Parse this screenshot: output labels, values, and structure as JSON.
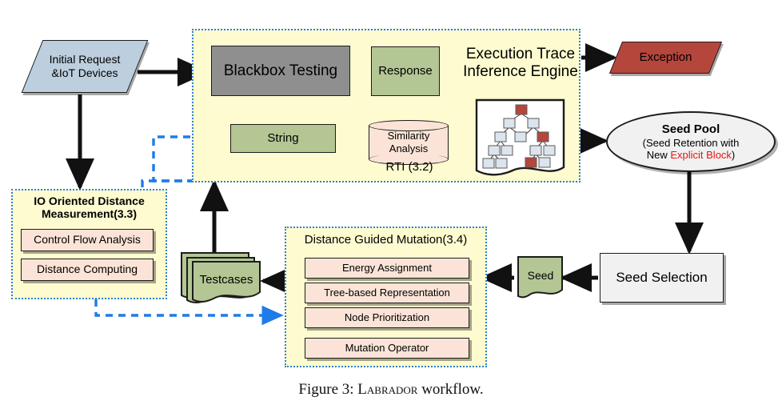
{
  "caption": {
    "prefix": "Figure 3: ",
    "name": "Labrador",
    "suffix": " workflow."
  },
  "colors": {
    "panel_fill": "#FDFBCF",
    "panel_border": "#2E7EE0",
    "green_box": "#B3C693",
    "grey_box": "#8F8F8F",
    "peach_box": "#FBE4D7",
    "light_grey_box": "#F1F1F1",
    "exception_red": "#B5463C",
    "initial_blue": "#BDCEDE",
    "blue_arrow": "#1F7BE8",
    "black_arrow": "#111111",
    "highlight_red": "#E81414"
  },
  "nodes": {
    "initial_request": {
      "line1": "Initial Request",
      "line2": "&IoT Devices",
      "shape": "parallelogram"
    },
    "blackbox_testing": {
      "label": "Blackbox Testing",
      "shape": "rect"
    },
    "response": {
      "label": "Response",
      "shape": "rect"
    },
    "string": {
      "label": "String",
      "shape": "rect"
    },
    "similarity_analysis": {
      "line1": "Similarity",
      "line2": "Analysis",
      "shape": "cylinder"
    },
    "rti_label": {
      "label": "RTI (3.2)"
    },
    "engine_title": {
      "line1": "Execution Trace",
      "line2": "Inference Engine"
    },
    "trace_tree": {
      "label": "execution-trace-tree",
      "shape": "document"
    },
    "exception": {
      "label": "Exception",
      "shape": "parallelogram"
    },
    "seed_pool": {
      "line1": "Seed Pool",
      "line2_a": "(Seed Retention with",
      "line3_a": "New ",
      "line3_b": "Explicit Block",
      "line3_c": ")",
      "shape": "ellipse"
    },
    "seed_selection": {
      "label": "Seed Selection",
      "shape": "rect"
    },
    "seed": {
      "label": "Seed",
      "shape": "document"
    },
    "testcases": {
      "label": "Testcases",
      "shape": "document-stack"
    },
    "io_panel": {
      "title_line1": "IO Oriented Distance",
      "title_line2": "Measurement(3.3)",
      "items": [
        {
          "label": "Control Flow Analysis"
        },
        {
          "label": "Distance Computing"
        }
      ]
    },
    "mutation_panel": {
      "title": "Distance Guided Mutation(3.4)",
      "items": [
        {
          "label": "Energy Assignment"
        },
        {
          "label": "Tree-based Representation"
        },
        {
          "label": "Node Prioritization"
        },
        {
          "label": "Mutation Operator"
        }
      ]
    }
  }
}
